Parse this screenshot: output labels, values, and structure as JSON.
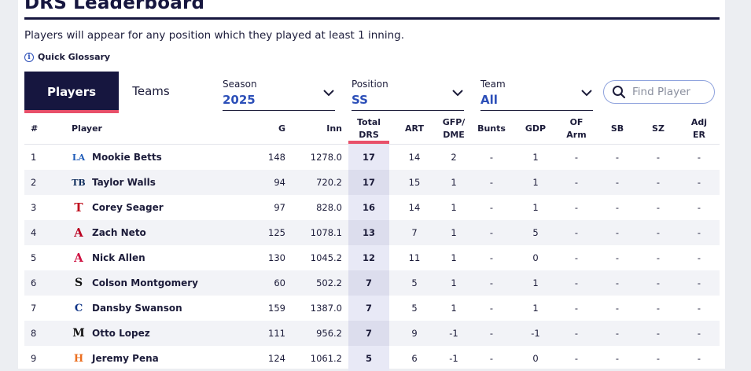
{
  "header": {
    "title": "DRS Leaderboard",
    "subtitle": "Players will appear for any position which they played at least 1 inning.",
    "glossary_label": "Quick Glossary"
  },
  "tabs": [
    {
      "label": "Players",
      "active": true
    },
    {
      "label": "Teams",
      "active": false
    }
  ],
  "filters": {
    "season": {
      "label": "Season",
      "value": "2025"
    },
    "position": {
      "label": "Position",
      "value": "SS"
    },
    "team": {
      "label": "Team",
      "value": "All"
    }
  },
  "search": {
    "placeholder": "Find Player"
  },
  "columns": {
    "rank": "#",
    "player": "Player",
    "g": "G",
    "inn": "Inn",
    "total_drs_1": "Total",
    "total_drs_2": "DRS",
    "art": "ART",
    "gfp_1": "GFP/",
    "gfp_2": "DME",
    "bunts": "Bunts",
    "gdp": "GDP",
    "of_1": "OF",
    "of_2": "Arm",
    "sb": "SB",
    "sz": "SZ",
    "adj_1": "Adj",
    "adj_2": "ER"
  },
  "rows": [
    {
      "rank": "1",
      "name": "Mookie Betts",
      "logo": "dodgers-logo",
      "g": "148",
      "inn": "1278.0",
      "drs": "17",
      "art": "14",
      "gfp": "2",
      "bunts": "-",
      "gdp": "1",
      "of": "-",
      "sb": "-",
      "sz": "-",
      "adj": "-"
    },
    {
      "rank": "2",
      "name": "Taylor Walls",
      "logo": "rays-logo",
      "g": "94",
      "inn": "720.2",
      "drs": "17",
      "art": "15",
      "gfp": "1",
      "bunts": "-",
      "gdp": "1",
      "of": "-",
      "sb": "-",
      "sz": "-",
      "adj": "-"
    },
    {
      "rank": "3",
      "name": "Corey Seager",
      "logo": "rangers-logo",
      "g": "97",
      "inn": "828.0",
      "drs": "16",
      "art": "14",
      "gfp": "1",
      "bunts": "-",
      "gdp": "1",
      "of": "-",
      "sb": "-",
      "sz": "-",
      "adj": "-"
    },
    {
      "rank": "4",
      "name": "Zach Neto",
      "logo": "angels-logo",
      "g": "125",
      "inn": "1078.1",
      "drs": "13",
      "art": "7",
      "gfp": "1",
      "bunts": "-",
      "gdp": "5",
      "of": "-",
      "sb": "-",
      "sz": "-",
      "adj": "-"
    },
    {
      "rank": "5",
      "name": "Nick Allen",
      "logo": "braves-logo",
      "g": "130",
      "inn": "1045.2",
      "drs": "12",
      "art": "11",
      "gfp": "1",
      "bunts": "-",
      "gdp": "0",
      "of": "-",
      "sb": "-",
      "sz": "-",
      "adj": "-"
    },
    {
      "rank": "6",
      "name": "Colson Montgomery",
      "logo": "white-sox-logo",
      "g": "60",
      "inn": "502.2",
      "drs": "7",
      "art": "5",
      "gfp": "1",
      "bunts": "-",
      "gdp": "1",
      "of": "-",
      "sb": "-",
      "sz": "-",
      "adj": "-"
    },
    {
      "rank": "7",
      "name": "Dansby Swanson",
      "logo": "cubs-logo",
      "g": "159",
      "inn": "1387.0",
      "drs": "7",
      "art": "5",
      "gfp": "1",
      "bunts": "-",
      "gdp": "1",
      "of": "-",
      "sb": "-",
      "sz": "-",
      "adj": "-"
    },
    {
      "rank": "8",
      "name": "Otto Lopez",
      "logo": "marlins-logo",
      "g": "111",
      "inn": "956.2",
      "drs": "7",
      "art": "9",
      "gfp": "-1",
      "bunts": "-",
      "gdp": "-1",
      "of": "-",
      "sb": "-",
      "sz": "-",
      "adj": "-"
    },
    {
      "rank": "9",
      "name": "Jeremy Pena",
      "logo": "astros-logo",
      "g": "124",
      "inn": "1061.2",
      "drs": "5",
      "art": "6",
      "gfp": "-1",
      "bunts": "-",
      "gdp": "0",
      "of": "-",
      "sb": "-",
      "sz": "-",
      "adj": "-"
    }
  ],
  "colors": {
    "navy": "#16163f",
    "accent_pink": "#e8506a",
    "link_blue": "#2c4fb8"
  }
}
